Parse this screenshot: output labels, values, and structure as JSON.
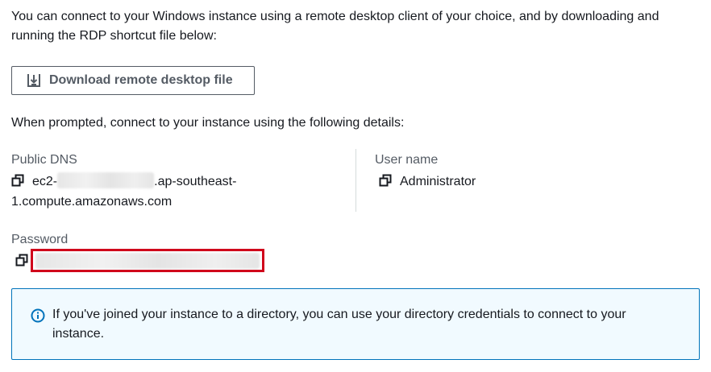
{
  "intro_text": "You can connect to your Windows instance using a remote desktop client of your choice, and by downloading and running the RDP shortcut file below:",
  "download_button": {
    "label": "Download remote desktop file",
    "icon": "download-icon"
  },
  "prompt_text": "When prompted, connect to your instance using the following details:",
  "public_dns": {
    "label": "Public DNS",
    "value_prefix": "ec2-",
    "value_suffix_line1": ".ap-southeast-",
    "value_line2": "1.compute.amazonaws.com",
    "icon": "copy-icon"
  },
  "user_name": {
    "label": "User name",
    "value": "Administrator",
    "icon": "copy-icon"
  },
  "password": {
    "label": "Password",
    "icon": "copy-icon"
  },
  "info_box": {
    "icon": "info-icon",
    "text": "If you've joined your instance to a directory, you can use your directory credentials to connect to your instance."
  },
  "colors": {
    "text": "#16191f",
    "label": "#545b64",
    "info_border": "#0073bb",
    "info_background": "#f1faff",
    "highlight": "#d0021b"
  }
}
